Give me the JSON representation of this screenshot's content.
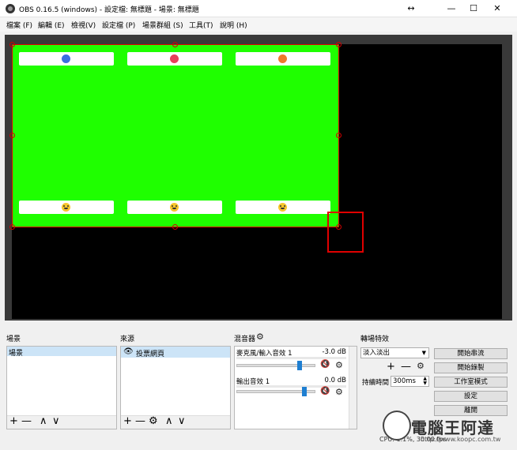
{
  "window": {
    "title": "OBS 0.16.5 (windows) - 設定檔: 無標題 - 場景: 無標題",
    "resize_glyph": "↔",
    "minimize_glyph": "—",
    "maximize_glyph": "☐",
    "close_glyph": "✕"
  },
  "menu": {
    "items": [
      "檔案 (F)",
      "編輯 (E)",
      "檢視(V)",
      "設定檔 (P)",
      "場景群組 (S)",
      "工具(T)",
      "說明 (H)"
    ]
  },
  "preview": {
    "source_color": "#1fff00",
    "reactions_top": [
      "like-icon",
      "love-icon",
      "angry-icon"
    ],
    "reactions_bottom": [
      "haha-icon",
      "wow-icon",
      "sad-icon"
    ]
  },
  "scenes": {
    "title": "場景",
    "items": [
      "場景"
    ],
    "add_glyph": "+",
    "remove_glyph": "—",
    "up_glyph": "∧",
    "down_glyph": "∨"
  },
  "sources": {
    "title": "來源",
    "items": [
      "投票網頁"
    ],
    "add_glyph": "+",
    "remove_glyph": "—",
    "gear_glyph": "⚙",
    "up_glyph": "∧",
    "down_glyph": "∨"
  },
  "mixer": {
    "title": "混音器",
    "gear_glyph": "⚙",
    "tracks": [
      {
        "name": "麥克風/輸入音效 1",
        "level": "-3.0 dB",
        "fader": 0.8
      },
      {
        "name": "輸出音效 1",
        "level": "0.0 dB",
        "fader": 0.86
      }
    ],
    "mute_glyph": "🔇"
  },
  "transitions": {
    "title": "轉場特效",
    "selected": "淡入淡出",
    "add_glyph": "+",
    "remove_glyph": "—",
    "gear_glyph": "⚙",
    "duration_label": "持續時間",
    "duration_value": "300ms"
  },
  "controls": {
    "buttons": [
      "開始串流",
      "開始錄製",
      "工作室模式",
      "設定",
      "離開"
    ]
  },
  "status": {
    "text": "CPU: 1.1%, 30.00 fps"
  },
  "watermark": {
    "text": "電腦王阿達",
    "url": "http://www.koopc.com.tw"
  }
}
